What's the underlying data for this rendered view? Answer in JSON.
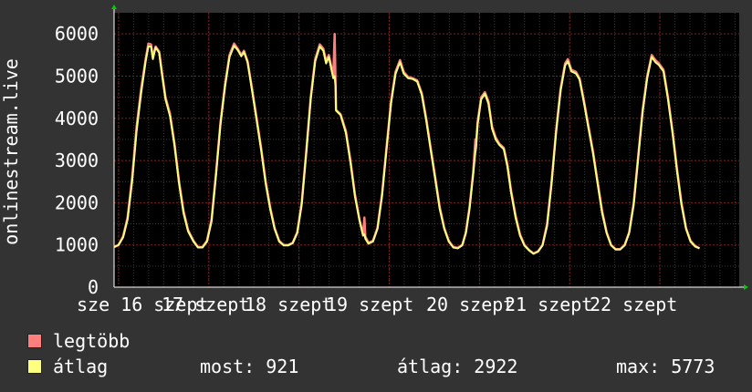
{
  "chart_data": {
    "type": "line",
    "ylabel": "onlinestream.live",
    "ylim": [
      0,
      6500
    ],
    "yticks": [
      0,
      1000,
      2000,
      3000,
      4000,
      5000,
      6000
    ],
    "xlim": [
      15.95,
      22.88
    ],
    "xticks": [
      {
        "x": 16,
        "label": "sze 16 szept"
      },
      {
        "x": 17,
        "label": "17 szept"
      },
      {
        "x": 18,
        "label": "18 szept"
      },
      {
        "x": 19,
        "label": "19 szept"
      },
      {
        "x": 20,
        "label": "20 szept"
      },
      {
        "x": 21,
        "label": "21 szept"
      },
      {
        "x": 22,
        "label": "22 szept"
      }
    ],
    "grid": true,
    "colors": {
      "max": "#ff7f7f",
      "avg": "#ffff7f",
      "background": "#000000",
      "grid": "#8b1a1a",
      "axis": "#ffffff"
    },
    "series": [
      {
        "name": "legtöbb",
        "color": "#ff7f7f",
        "points": [
          [
            15.95,
            950
          ],
          [
            16.0,
            1000
          ],
          [
            16.05,
            1200
          ],
          [
            16.1,
            1650
          ],
          [
            16.15,
            2600
          ],
          [
            16.2,
            3800
          ],
          [
            16.25,
            4700
          ],
          [
            16.3,
            5400
          ],
          [
            16.33,
            5770
          ],
          [
            16.36,
            5750
          ],
          [
            16.38,
            5450
          ],
          [
            16.41,
            5700
          ],
          [
            16.45,
            5580
          ],
          [
            16.48,
            5100
          ],
          [
            16.52,
            4500
          ],
          [
            16.57,
            4100
          ],
          [
            16.62,
            3400
          ],
          [
            16.67,
            2500
          ],
          [
            16.72,
            1800
          ],
          [
            16.77,
            1350
          ],
          [
            16.83,
            1100
          ],
          [
            16.88,
            950
          ],
          [
            16.93,
            950
          ],
          [
            16.98,
            1100
          ],
          [
            17.03,
            1600
          ],
          [
            17.08,
            2700
          ],
          [
            17.13,
            3900
          ],
          [
            17.18,
            4800
          ],
          [
            17.23,
            5500
          ],
          [
            17.28,
            5770
          ],
          [
            17.32,
            5650
          ],
          [
            17.36,
            5500
          ],
          [
            17.39,
            5600
          ],
          [
            17.43,
            5350
          ],
          [
            17.48,
            4700
          ],
          [
            17.53,
            4000
          ],
          [
            17.58,
            3300
          ],
          [
            17.63,
            2500
          ],
          [
            17.68,
            1900
          ],
          [
            17.73,
            1400
          ],
          [
            17.78,
            1100
          ],
          [
            17.83,
            1000
          ],
          [
            17.88,
            1000
          ],
          [
            17.93,
            1050
          ],
          [
            17.98,
            1300
          ],
          [
            18.03,
            2000
          ],
          [
            18.08,
            3200
          ],
          [
            18.13,
            4500
          ],
          [
            18.18,
            5400
          ],
          [
            18.23,
            5750
          ],
          [
            18.27,
            5650
          ],
          [
            18.3,
            5350
          ],
          [
            18.33,
            5500
          ],
          [
            18.36,
            5200
          ],
          [
            18.38,
            5000
          ],
          [
            18.395,
            6000
          ],
          [
            18.405,
            4800
          ],
          [
            18.41,
            4200
          ],
          [
            18.46,
            4100
          ],
          [
            18.52,
            3700
          ],
          [
            18.57,
            3000
          ],
          [
            18.62,
            2200
          ],
          [
            18.67,
            1600
          ],
          [
            18.71,
            1250
          ],
          [
            18.725,
            1650
          ],
          [
            18.735,
            1200
          ],
          [
            18.77,
            1050
          ],
          [
            18.82,
            1100
          ],
          [
            18.87,
            1400
          ],
          [
            18.92,
            2200
          ],
          [
            18.97,
            3300
          ],
          [
            19.02,
            4400
          ],
          [
            19.07,
            5100
          ],
          [
            19.12,
            5380
          ],
          [
            19.16,
            5100
          ],
          [
            19.21,
            4980
          ],
          [
            19.26,
            4950
          ],
          [
            19.31,
            4900
          ],
          [
            19.36,
            4600
          ],
          [
            19.41,
            4000
          ],
          [
            19.46,
            3300
          ],
          [
            19.51,
            2600
          ],
          [
            19.56,
            1900
          ],
          [
            19.61,
            1400
          ],
          [
            19.66,
            1100
          ],
          [
            19.71,
            950
          ],
          [
            19.76,
            930
          ],
          [
            19.81,
            1000
          ],
          [
            19.85,
            1300
          ],
          [
            19.89,
            1900
          ],
          [
            19.93,
            2700
          ],
          [
            19.955,
            3500
          ],
          [
            19.96,
            3300
          ],
          [
            19.98,
            3900
          ],
          [
            20.02,
            4500
          ],
          [
            20.06,
            4620
          ],
          [
            20.1,
            4400
          ],
          [
            20.14,
            3800
          ],
          [
            20.18,
            3550
          ],
          [
            20.22,
            3400
          ],
          [
            20.27,
            3300
          ],
          [
            20.31,
            2900
          ],
          [
            20.35,
            2300
          ],
          [
            20.4,
            1700
          ],
          [
            20.45,
            1250
          ],
          [
            20.5,
            1000
          ],
          [
            20.55,
            880
          ],
          [
            20.6,
            800
          ],
          [
            20.65,
            850
          ],
          [
            20.7,
            1000
          ],
          [
            20.75,
            1500
          ],
          [
            20.8,
            2500
          ],
          [
            20.85,
            3700
          ],
          [
            20.9,
            4700
          ],
          [
            20.95,
            5300
          ],
          [
            20.98,
            5400
          ],
          [
            21.02,
            5150
          ],
          [
            21.07,
            5100
          ],
          [
            21.11,
            4950
          ],
          [
            21.16,
            4400
          ],
          [
            21.21,
            3800
          ],
          [
            21.26,
            3200
          ],
          [
            21.31,
            2500
          ],
          [
            21.36,
            1800
          ],
          [
            21.41,
            1300
          ],
          [
            21.46,
            1000
          ],
          [
            21.51,
            900
          ],
          [
            21.56,
            900
          ],
          [
            21.61,
            1000
          ],
          [
            21.66,
            1300
          ],
          [
            21.71,
            2000
          ],
          [
            21.76,
            3100
          ],
          [
            21.81,
            4200
          ],
          [
            21.86,
            5000
          ],
          [
            21.91,
            5500
          ],
          [
            21.95,
            5380
          ],
          [
            21.99,
            5300
          ],
          [
            22.04,
            5150
          ],
          [
            22.09,
            4500
          ],
          [
            22.14,
            3700
          ],
          [
            22.19,
            2800
          ],
          [
            22.24,
            2000
          ],
          [
            22.29,
            1400
          ],
          [
            22.34,
            1100
          ],
          [
            22.39,
            980
          ],
          [
            22.44,
            921
          ]
        ]
      },
      {
        "name": "átlag",
        "color": "#ffff7f",
        "points": [
          [
            15.95,
            950
          ],
          [
            16.0,
            1000
          ],
          [
            16.05,
            1180
          ],
          [
            16.1,
            1600
          ],
          [
            16.15,
            2500
          ],
          [
            16.2,
            3700
          ],
          [
            16.25,
            4600
          ],
          [
            16.3,
            5350
          ],
          [
            16.33,
            5700
          ],
          [
            16.36,
            5700
          ],
          [
            16.38,
            5400
          ],
          [
            16.41,
            5680
          ],
          [
            16.45,
            5550
          ],
          [
            16.48,
            5050
          ],
          [
            16.52,
            4450
          ],
          [
            16.57,
            4050
          ],
          [
            16.62,
            3350
          ],
          [
            16.67,
            2450
          ],
          [
            16.72,
            1750
          ],
          [
            16.77,
            1320
          ],
          [
            16.83,
            1080
          ],
          [
            16.88,
            940
          ],
          [
            16.93,
            940
          ],
          [
            16.98,
            1080
          ],
          [
            17.03,
            1550
          ],
          [
            17.08,
            2650
          ],
          [
            17.13,
            3850
          ],
          [
            17.18,
            4750
          ],
          [
            17.23,
            5450
          ],
          [
            17.28,
            5720
          ],
          [
            17.32,
            5620
          ],
          [
            17.36,
            5470
          ],
          [
            17.39,
            5570
          ],
          [
            17.43,
            5320
          ],
          [
            17.48,
            4650
          ],
          [
            17.53,
            3950
          ],
          [
            17.58,
            3250
          ],
          [
            17.63,
            2450
          ],
          [
            17.68,
            1850
          ],
          [
            17.73,
            1380
          ],
          [
            17.78,
            1080
          ],
          [
            17.83,
            990
          ],
          [
            17.88,
            990
          ],
          [
            17.93,
            1040
          ],
          [
            17.98,
            1280
          ],
          [
            18.03,
            1950
          ],
          [
            18.08,
            3150
          ],
          [
            18.13,
            4450
          ],
          [
            18.18,
            5350
          ],
          [
            18.23,
            5700
          ],
          [
            18.27,
            5600
          ],
          [
            18.3,
            5300
          ],
          [
            18.33,
            5450
          ],
          [
            18.36,
            5150
          ],
          [
            18.38,
            4950
          ],
          [
            18.395,
            5000
          ],
          [
            18.405,
            4750
          ],
          [
            18.41,
            4180
          ],
          [
            18.46,
            4080
          ],
          [
            18.52,
            3650
          ],
          [
            18.57,
            2950
          ],
          [
            18.62,
            2150
          ],
          [
            18.67,
            1580
          ],
          [
            18.71,
            1220
          ],
          [
            18.725,
            1250
          ],
          [
            18.735,
            1150
          ],
          [
            18.77,
            1030
          ],
          [
            18.82,
            1080
          ],
          [
            18.87,
            1380
          ],
          [
            18.92,
            2150
          ],
          [
            18.97,
            3250
          ],
          [
            19.02,
            4350
          ],
          [
            19.07,
            5050
          ],
          [
            19.12,
            5330
          ],
          [
            19.16,
            5060
          ],
          [
            19.21,
            4950
          ],
          [
            19.26,
            4930
          ],
          [
            19.31,
            4870
          ],
          [
            19.36,
            4560
          ],
          [
            19.41,
            3950
          ],
          [
            19.46,
            3250
          ],
          [
            19.51,
            2550
          ],
          [
            19.56,
            1850
          ],
          [
            19.61,
            1380
          ],
          [
            19.66,
            1080
          ],
          [
            19.71,
            940
          ],
          [
            19.76,
            920
          ],
          [
            19.81,
            990
          ],
          [
            19.85,
            1280
          ],
          [
            19.89,
            1850
          ],
          [
            19.93,
            2650
          ],
          [
            19.955,
            3200
          ],
          [
            19.96,
            3250
          ],
          [
            19.98,
            3850
          ],
          [
            20.02,
            4450
          ],
          [
            20.06,
            4580
          ],
          [
            20.1,
            4350
          ],
          [
            20.14,
            3750
          ],
          [
            20.18,
            3500
          ],
          [
            20.22,
            3370
          ],
          [
            20.27,
            3270
          ],
          [
            20.31,
            2850
          ],
          [
            20.35,
            2250
          ],
          [
            20.4,
            1650
          ],
          [
            20.45,
            1220
          ],
          [
            20.5,
            980
          ],
          [
            20.55,
            870
          ],
          [
            20.6,
            790
          ],
          [
            20.65,
            840
          ],
          [
            20.7,
            990
          ],
          [
            20.75,
            1450
          ],
          [
            20.8,
            2450
          ],
          [
            20.85,
            3650
          ],
          [
            20.9,
            4650
          ],
          [
            20.95,
            5250
          ],
          [
            20.98,
            5350
          ],
          [
            21.02,
            5110
          ],
          [
            21.07,
            5060
          ],
          [
            21.11,
            4920
          ],
          [
            21.16,
            4350
          ],
          [
            21.21,
            3750
          ],
          [
            21.26,
            3150
          ],
          [
            21.31,
            2450
          ],
          [
            21.36,
            1750
          ],
          [
            21.41,
            1280
          ],
          [
            21.46,
            990
          ],
          [
            21.51,
            890
          ],
          [
            21.56,
            890
          ],
          [
            21.61,
            990
          ],
          [
            21.66,
            1280
          ],
          [
            21.71,
            1950
          ],
          [
            21.76,
            3050
          ],
          [
            21.81,
            4150
          ],
          [
            21.86,
            4950
          ],
          [
            21.91,
            5450
          ],
          [
            21.95,
            5330
          ],
          [
            21.99,
            5260
          ],
          [
            22.04,
            5110
          ],
          [
            22.09,
            4450
          ],
          [
            22.14,
            3650
          ],
          [
            22.19,
            2750
          ],
          [
            22.24,
            1950
          ],
          [
            22.29,
            1380
          ],
          [
            22.34,
            1080
          ],
          [
            22.39,
            960
          ],
          [
            22.44,
            921
          ]
        ]
      }
    ]
  },
  "legend": {
    "items": [
      {
        "label": "legtöbb",
        "color": "#ff7f7f"
      },
      {
        "label": "átlag",
        "color": "#ffff7f"
      }
    ]
  },
  "stats": {
    "current": "most: 921",
    "average": "átlag: 2922",
    "max": "max: 5773"
  }
}
